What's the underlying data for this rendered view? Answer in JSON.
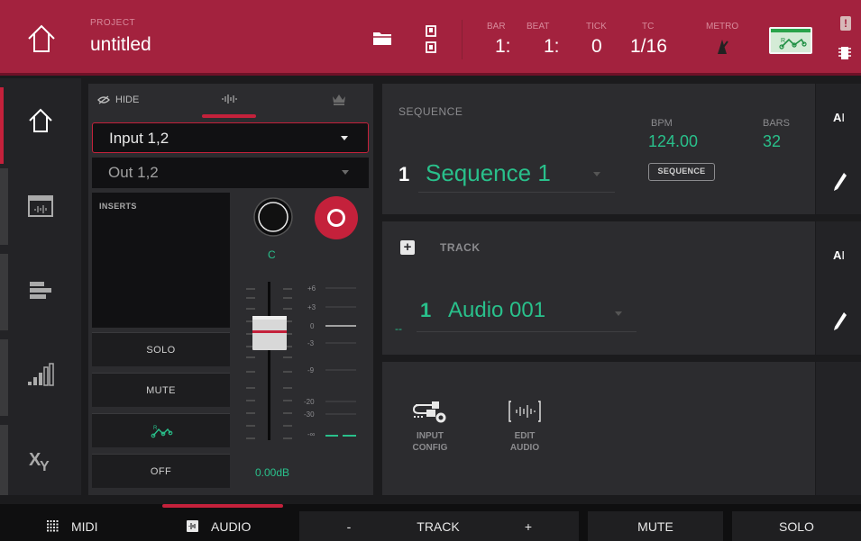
{
  "header": {
    "project_label": "PROJECT",
    "project_name": "untitled",
    "bar_label": "BAR",
    "bar_value": "1:",
    "beat_label": "BEAT",
    "beat_value": "1:",
    "tick_label": "TICK",
    "tick_value": "0",
    "tc_label": "TC",
    "tc_value": "1/16",
    "metro_label": "METRO",
    "alert_glyph": "!"
  },
  "mixer": {
    "hide_label": "HIDE",
    "input_value": "Input 1,2",
    "output_value": "Out 1,2",
    "inserts_label": "INSERTS",
    "solo_label": "SOLO",
    "mute_label": "MUTE",
    "off_label": "OFF",
    "pan_value": "C",
    "level_value": "0.00dB",
    "scale": [
      "+6",
      "+3",
      "0",
      "-3",
      "-9",
      "-20",
      "-30",
      "-∞"
    ]
  },
  "sequence": {
    "label": "SEQUENCE",
    "number": "1",
    "name": "Sequence 1",
    "bpm_label": "BPM",
    "bpm_value": "124.00",
    "bars_label": "BARS",
    "bars_value": "32",
    "badge": "SEQUENCE"
  },
  "track": {
    "label": "TRACK",
    "plus": "+",
    "number": "1",
    "name": "Audio 001",
    "dash": "--"
  },
  "tools": {
    "input_config_line1": "INPUT",
    "input_config_line2": "CONFIG",
    "edit_audio_line1": "EDIT",
    "edit_audio_line2": "AUDIO"
  },
  "side": {
    "rename_glyph": "A"
  },
  "bottom": {
    "midi": "MIDI",
    "audio": "AUDIO",
    "minus": "-",
    "track": "TRACK",
    "plus": "+",
    "mute": "MUTE",
    "solo": "SOLO"
  },
  "colors": {
    "accent_red": "#c4213b",
    "header_bg": "#a3223e",
    "accent_green": "#29c08b"
  }
}
